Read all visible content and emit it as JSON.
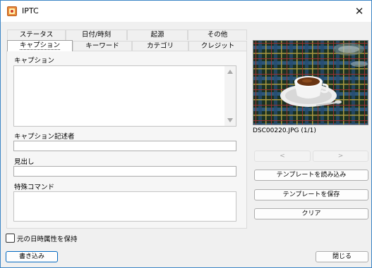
{
  "window": {
    "title": "IPTC",
    "close_glyph": "✕"
  },
  "tabs_back": [
    "ステータス",
    "日付/時刻",
    "起源",
    "その他"
  ],
  "tabs_front": [
    "キャプション",
    "キーワード",
    "カテゴリ",
    "クレジット"
  ],
  "selected_tab": "キャプション",
  "fields": {
    "caption_label": "キャプション",
    "caption_value": "",
    "writer_label": "キャプション記述者",
    "writer_value": "",
    "headline_label": "見出し",
    "headline_value": "",
    "instructions_label": "特殊コマンド",
    "instructions_value": ""
  },
  "preview": {
    "filename": "DSC00220.JPG (1/1)"
  },
  "nav": {
    "prev": "<",
    "next": ">"
  },
  "buttons": {
    "load_template": "テンプレートを読み込み",
    "save_template": "テンプレートを保存",
    "clear": "クリア",
    "write": "書き込み",
    "close": "閉じる"
  },
  "keep_date_checkbox": {
    "label": "元の日時属性を保持",
    "checked": false
  },
  "icons": [
    "app-icon",
    "close-icon",
    "scroll-up-icon",
    "scroll-down-icon"
  ]
}
